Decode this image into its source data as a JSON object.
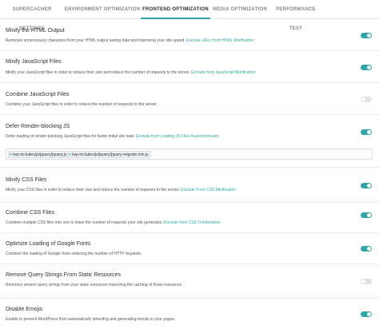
{
  "tabs": [
    {
      "label": "SUPERCACHER SETTINGS",
      "active": false
    },
    {
      "label": "ENVIRONMENT OPTIMIZATION",
      "active": false
    },
    {
      "label": "FRONTEND OPTIMIZATION",
      "active": true
    },
    {
      "label": "MEDIA OPTIMIZATION",
      "active": false
    },
    {
      "label": "PERFORMANCE TEST",
      "active": false
    }
  ],
  "settings": [
    {
      "title": "Minify the HTML Output",
      "desc": "Removes unnecessary characters from your HTML output saving data and improving your site speed.",
      "link": "Exclude URLs from HTML Minification",
      "enabled": true
    },
    {
      "title": "Minify JavaScript Files",
      "desc": "Minify your JavaScript files in order to reduce their size and reduce the number of requests to the server.",
      "link": "Exclude from JavaScript Minification",
      "enabled": true
    },
    {
      "title": "Combine JavaScript Files",
      "desc": "Combine your JavaScript files in order to reduce the number of requests to the server.",
      "link": "",
      "enabled": false
    },
    {
      "title": "Defer Render-blocking JS",
      "desc": "Defer loading of render-blocking JavaScript files for faster initial site load.",
      "link": "Exclude from Loading JS Files Asynchronously",
      "enabled": true
    },
    {
      "title": "Minify CSS Files",
      "desc": "Minify your CSS files in order to reduce their size and reduce the number of requests to the server.",
      "link": "Exclude From CSS Minification",
      "enabled": true
    },
    {
      "title": "Combine CSS Files",
      "desc": "Combine multiple CSS files into one to lower the number of requests your site generates.",
      "link": "Exclude from CSS Combination",
      "enabled": true
    },
    {
      "title": "Optimize Loading of Google Fonts",
      "desc": "Combine the loading of Google fonts reducing the number of HTTP requests.",
      "link": "",
      "enabled": true
    },
    {
      "title": "Remove Query Strings From Static Resources",
      "desc": "Removes version query strings from your static resources improving the caching of those resources.",
      "link": "",
      "enabled": false
    },
    {
      "title": "Disable Emojis",
      "desc": "Enable to prevent WordPress from automatically detecting and generating emojis in your pages.",
      "link": "",
      "enabled": true
    }
  ],
  "defer_excludes": {
    "remove_symbol": "×",
    "tags": [
      "/wp-includes/js/jquery/jquery.js",
      "/wp-includes/js/jquery/jquery-migrate.min.js"
    ]
  },
  "colors": {
    "accent": "#2fa6a4",
    "toggle_off": "#e2e2e2"
  }
}
